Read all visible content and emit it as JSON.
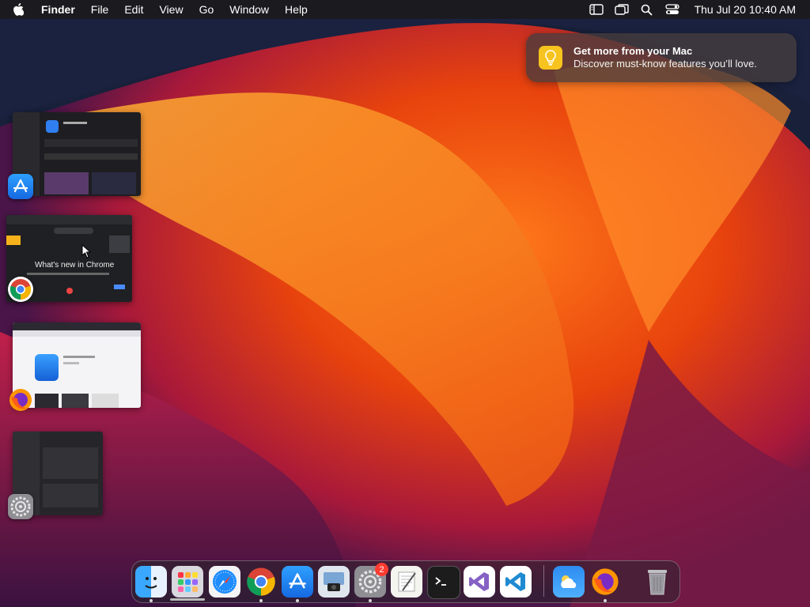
{
  "menubar": {
    "app_name": "Finder",
    "menus": [
      "File",
      "Edit",
      "View",
      "Go",
      "Window",
      "Help"
    ],
    "status_icons": [
      "sidebar-icon",
      "screen-mirroring-icon",
      "spotlight-search-icon",
      "control-center-icon"
    ],
    "clock": "Thu Jul 20  10:40 AM"
  },
  "notification": {
    "title": "Get more from your Mac",
    "body": "Discover must-know features you’ll love.",
    "icon": "lightbulb-icon"
  },
  "stage_manager": {
    "windows": [
      {
        "app": "App Store",
        "icon": "app-store-icon"
      },
      {
        "app": "Google Chrome",
        "icon": "chrome-icon",
        "preview_text": "What's new in Chrome"
      },
      {
        "app": "Firefox",
        "icon": "firefox-icon"
      },
      {
        "app": "System Settings",
        "icon": "system-settings-icon"
      }
    ]
  },
  "dock": {
    "items": [
      {
        "name": "Finder",
        "running": true
      },
      {
        "name": "Launchpad",
        "running": false
      },
      {
        "name": "Safari",
        "running": false
      },
      {
        "name": "Google Chrome",
        "running": true
      },
      {
        "name": "App Store",
        "running": true
      },
      {
        "name": "Preview",
        "running": false
      },
      {
        "name": "System Settings",
        "running": true,
        "badge": "2"
      },
      {
        "name": "TextEdit",
        "running": false
      },
      {
        "name": "Terminal",
        "running": false
      },
      {
        "name": "Visual Studio",
        "running": false
      },
      {
        "name": "Visual Studio Code",
        "running": false
      },
      {
        "name": "Weather",
        "running": false
      },
      {
        "name": "Firefox",
        "running": true
      },
      {
        "name": "Trash",
        "running": false
      }
    ]
  },
  "colors": {
    "menubar_bg": "#1b1b1f",
    "notification_accent": "#f7c31e",
    "wallpaper_orange": "#f05a12",
    "wallpaper_purple": "#5a1a4a"
  }
}
